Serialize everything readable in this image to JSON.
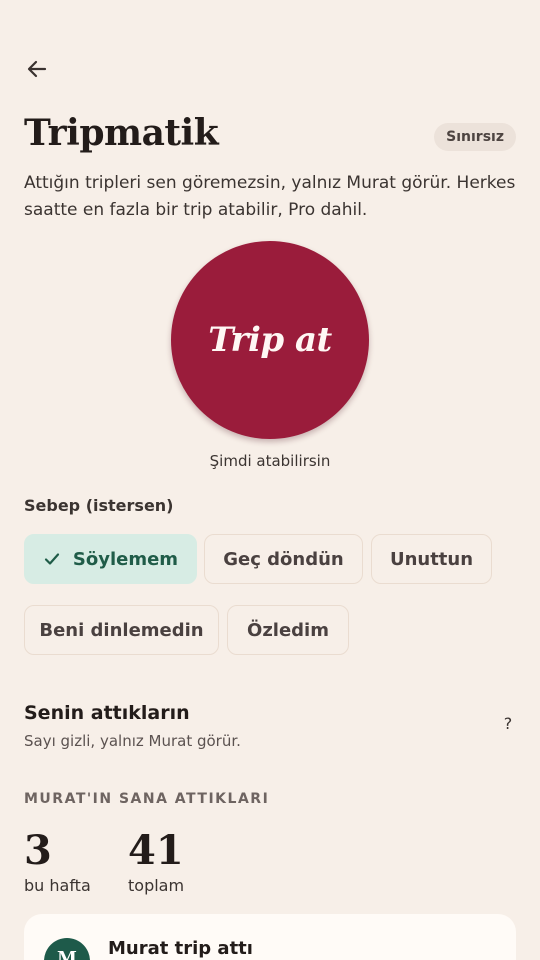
{
  "header": {
    "title": "Tripmatik",
    "badge": "Sınırsız",
    "description": "Attığın tripleri sen göremezsin, yalnız Murat görür. Herkes saatte en fazla bir trip atabilir, Pro dahil."
  },
  "trip_button": {
    "label": "Trip at",
    "status": "Şimdi atabilirsin"
  },
  "reasons": {
    "label": "Sebep (istersen)",
    "options": [
      "Söylemem",
      "Geç döndün",
      "Unuttun",
      "Beni dinlemedin",
      "Özledim"
    ],
    "selected": "Söylemem"
  },
  "sent_section": {
    "title": "Senin attıkların",
    "subtitle": "Sayı gizli, yalnız Murat görür.",
    "help": "?"
  },
  "received_section": {
    "label": "MURAT'IN SANA ATTIKLARI",
    "stats": [
      {
        "value": "3",
        "label": "bu hafta"
      },
      {
        "value": "41",
        "label": "toplam"
      }
    ]
  },
  "activity": {
    "avatar_initial": "M",
    "title": "Murat trip attı"
  },
  "icons": {
    "back": "arrow-left-icon",
    "check": "check-icon",
    "help": "question-icon"
  },
  "colors": {
    "background": "#f7efe8",
    "trip_button": "#9a1c3b",
    "selected_chip": "#d7ece4",
    "selected_text": "#1f5c48",
    "avatar": "#1e5a4a"
  }
}
